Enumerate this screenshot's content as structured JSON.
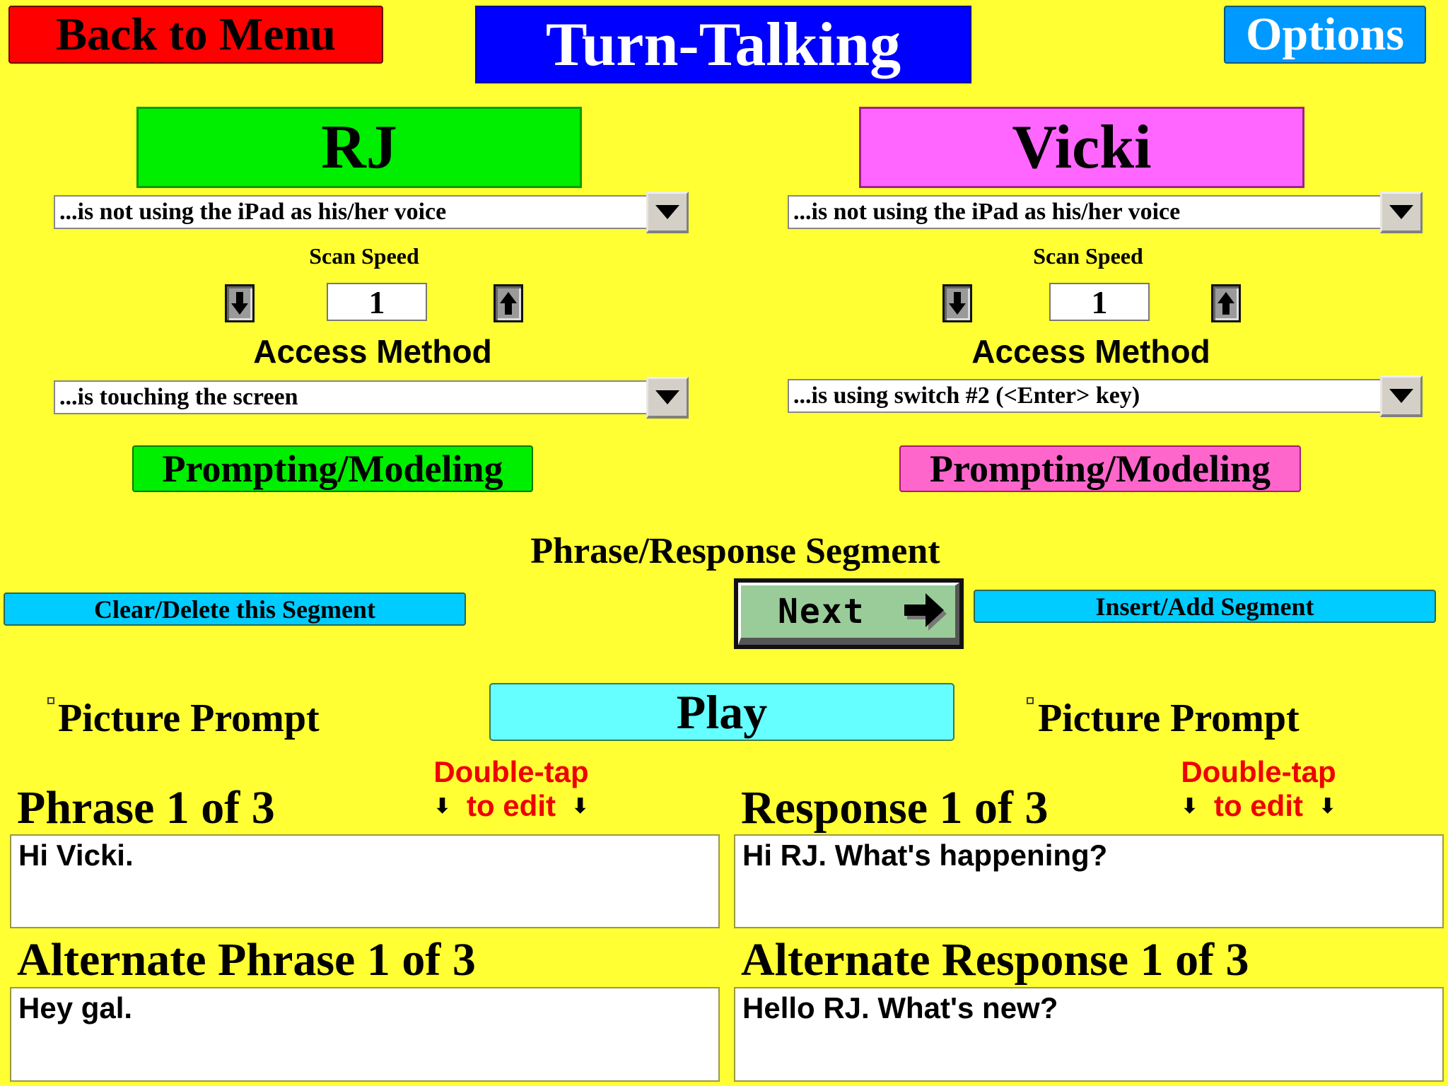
{
  "header": {
    "back_label": "Back to Menu",
    "title": "Turn-Talking",
    "options_label": "Options"
  },
  "colors": {
    "background": "#ffff33",
    "back_button": "#ff0000",
    "title_bar": "#0000ff",
    "options_button": "#0099ff",
    "rj": "#00ee00",
    "vicki": "#ff66ff",
    "cyan_button": "#00ccff",
    "play_button": "#66ffff",
    "next_button": "#99cc99",
    "hint_text": "#ee0000"
  },
  "participants": [
    {
      "name": "RJ",
      "voice_select": "...is not using the iPad as his/her voice",
      "scan_speed_label": "Scan Speed",
      "scan_speed": "1",
      "access_method_label": "Access Method",
      "access_select": "...is touching the screen",
      "prompting_label": "Prompting/Modeling"
    },
    {
      "name": "Vicki",
      "voice_select": "...is not using the iPad as his/her voice",
      "scan_speed_label": "Scan Speed",
      "scan_speed": "1",
      "access_method_label": "Access Method",
      "access_select": "...is using switch #2 (<Enter> key)",
      "prompting_label": "Prompting/Modeling"
    }
  ],
  "segment": {
    "title": "Phrase/Response Segment",
    "clear_label": "Clear/Delete this Segment",
    "next_label": "Next",
    "insert_label": "Insert/Add Segment",
    "play_label": "Play"
  },
  "picture_prompt": {
    "left_label": "Picture Prompt",
    "right_label": "Picture Prompt"
  },
  "hint": {
    "line1": "Double-tap",
    "line2": "to edit",
    "arrow": "⬇"
  },
  "phrase": {
    "header": "Phrase 1 of 3",
    "text": "Hi Vicki.",
    "alt_header": "Alternate Phrase 1 of 3",
    "alt_text": "Hey gal."
  },
  "response": {
    "header": "Response 1 of 3",
    "text": "Hi RJ.  What's happening?",
    "alt_header": "Alternate Response 1 of 3",
    "alt_text": "Hello RJ. What's new?"
  }
}
